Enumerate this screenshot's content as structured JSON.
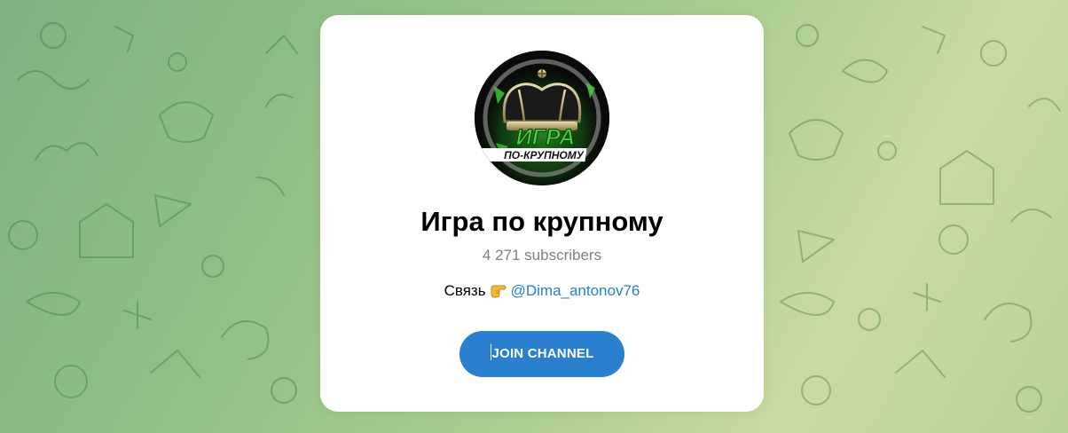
{
  "channel": {
    "title": "Игра по крупному",
    "subscribers": "4 271 subscribers",
    "description_text": "Связь",
    "description_emoji": "pointing-right-emoji",
    "description_link": "@Dima_antonov76",
    "avatar_text_top": "ИГРА",
    "avatar_text_bottom": "ПО-КРУПНОМУ"
  },
  "actions": {
    "join_label": "JOIN CHANNEL"
  },
  "colors": {
    "accent": "#2a7fcf",
    "link": "#2481cc",
    "muted": "#7f7f7f",
    "background": "#8fbf86",
    "avatar_green": "#3fd43a"
  }
}
